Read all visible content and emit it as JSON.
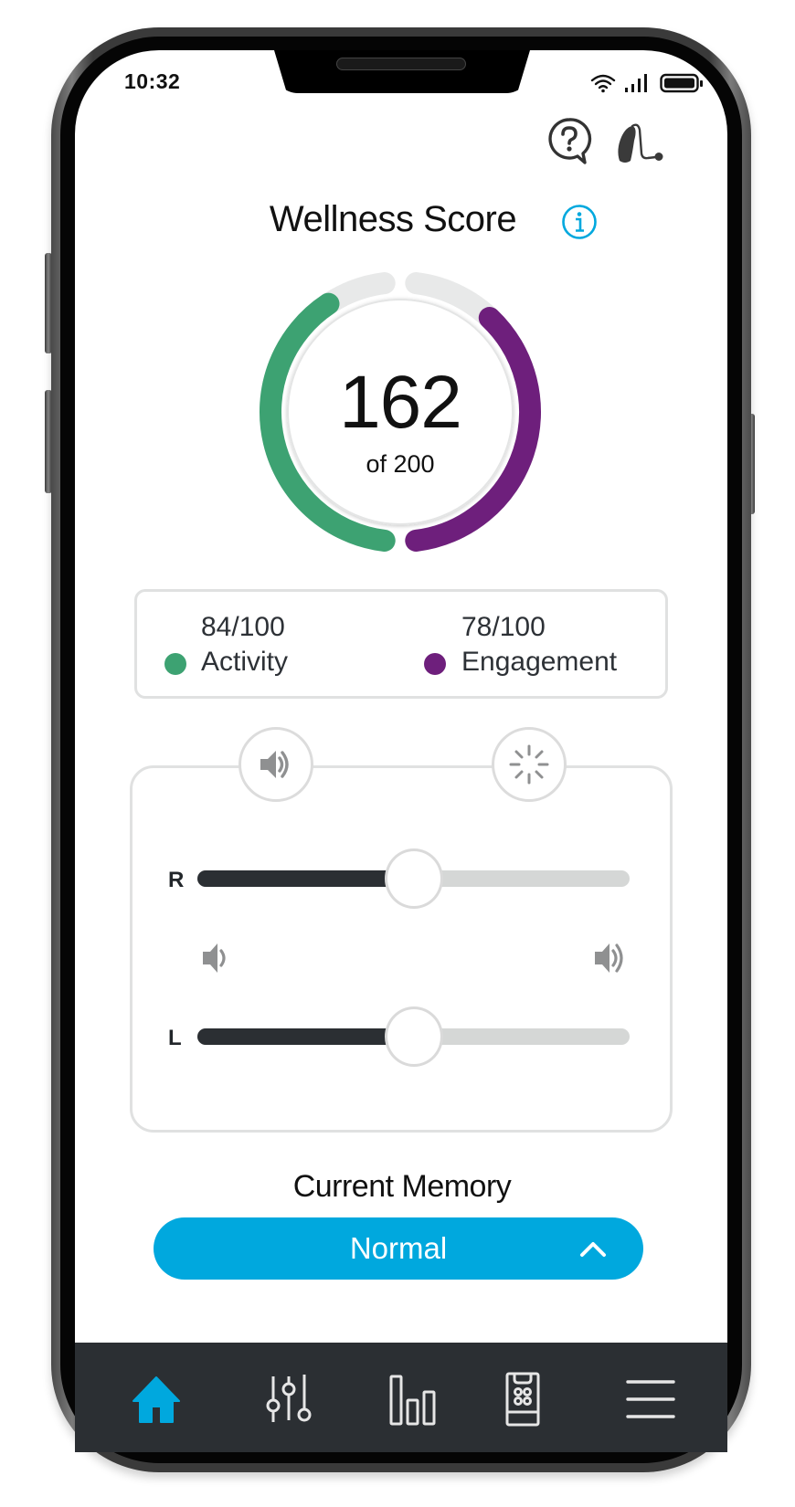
{
  "status_bar": {
    "time": "10:32",
    "icons": [
      "wifi-icon",
      "cellular-signal-icon",
      "battery-icon"
    ]
  },
  "header": {
    "icons": [
      "help-chat-icon",
      "hearing-aid-icon"
    ]
  },
  "wellness": {
    "title": "Wellness Score",
    "info_icon": "info-icon",
    "score": "162",
    "score_suffix": "of 200",
    "score_value": 162,
    "score_max": 200
  },
  "chart_data": {
    "type": "pie",
    "title": "Wellness Score",
    "total": 162,
    "max": 200,
    "series": [
      {
        "name": "Activity",
        "value": 84,
        "max": 100,
        "color": "#3da272"
      },
      {
        "name": "Engagement",
        "value": 78,
        "max": 100,
        "color": "#6e1f7c"
      }
    ],
    "track_color": "#e8e9e9"
  },
  "metrics": [
    {
      "value": "84/100",
      "label": "Activity",
      "color": "#3da272"
    },
    {
      "value": "78/100",
      "label": "Engagement",
      "color": "#6e1f7c"
    }
  ],
  "controls": {
    "mode_buttons": [
      {
        "icon": "volume-icon",
        "active": true
      },
      {
        "icon": "sparkle-brightness-icon",
        "active": false
      }
    ],
    "sliders": [
      {
        "label": "R",
        "value_fraction": 0.5
      },
      {
        "label": "L",
        "value_fraction": 0.5
      }
    ],
    "min_icon": "volume-low-icon",
    "max_icon": "volume-high-icon"
  },
  "memory": {
    "title": "Current Memory",
    "selected": "Normal",
    "accent": "#00a8de"
  },
  "nav": {
    "items": [
      {
        "icon": "home-icon",
        "active": true
      },
      {
        "icon": "equalizer-sliders-icon",
        "active": false
      },
      {
        "icon": "bar-chart-icon",
        "active": false
      },
      {
        "icon": "remote-control-icon",
        "active": false
      },
      {
        "icon": "hamburger-menu-icon",
        "active": false
      }
    ],
    "active_color": "#00a8de",
    "inactive_color": "#e6e6e6"
  }
}
